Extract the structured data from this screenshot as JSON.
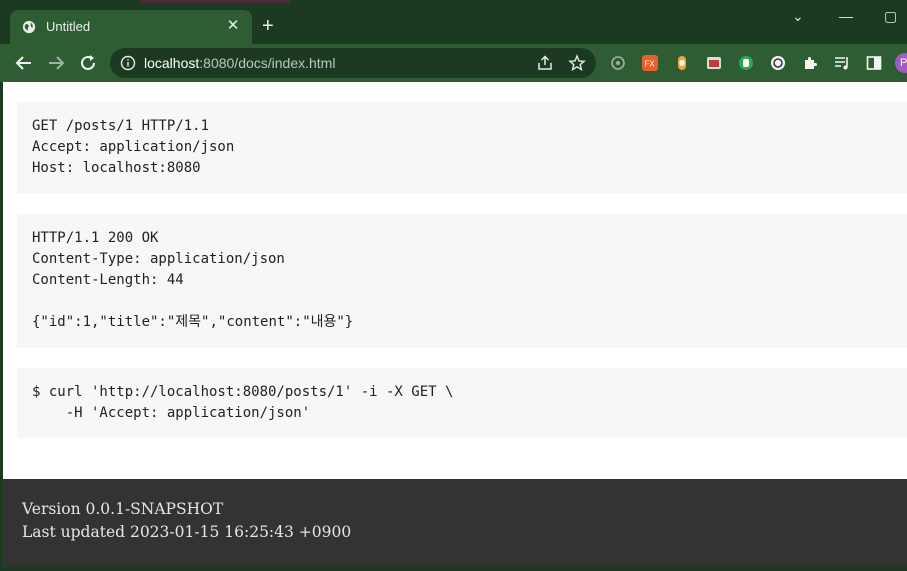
{
  "browser": {
    "tab_title": "Untitled",
    "tab_close": "✕",
    "new_tab": "+",
    "window_controls": {
      "minimize": "—",
      "restore": "▢",
      "dropdown": "⌄"
    },
    "url_host": "localhost",
    "url_rest": ":8080/docs/index.html",
    "profile_initial": "P",
    "extensions": [
      "google-lens-icon",
      "fx-extension-icon",
      "record-extension-icon",
      "screenshot-extension-icon",
      "green-extension-icon",
      "circle-extension-icon",
      "puzzle-extensions-icon",
      "media-queue-icon",
      "side-panel-icon"
    ]
  },
  "content": {
    "request": [
      "GET /posts/1 HTTP/1.1",
      "Accept: application/json",
      "Host: localhost:8080"
    ],
    "response": [
      "HTTP/1.1 200 OK",
      "Content-Type: application/json",
      "Content-Length: 44",
      "",
      "{\"id\":1,\"title\":\"제목\",\"content\":\"내용\"}"
    ],
    "curl": [
      "$ curl 'http://localhost:8080/posts/1' -i -X GET \\",
      "    -H 'Accept: application/json'"
    ]
  },
  "footer": {
    "version": "Version 0.0.1-SNAPSHOT",
    "last_updated": "Last updated 2023-01-15 16:25:43 +0900"
  },
  "colors": {
    "frame": "#1c3a22",
    "toolbar": "#2e5d34",
    "code_bg": "#f7f7f8",
    "footer_bg": "#333333"
  }
}
